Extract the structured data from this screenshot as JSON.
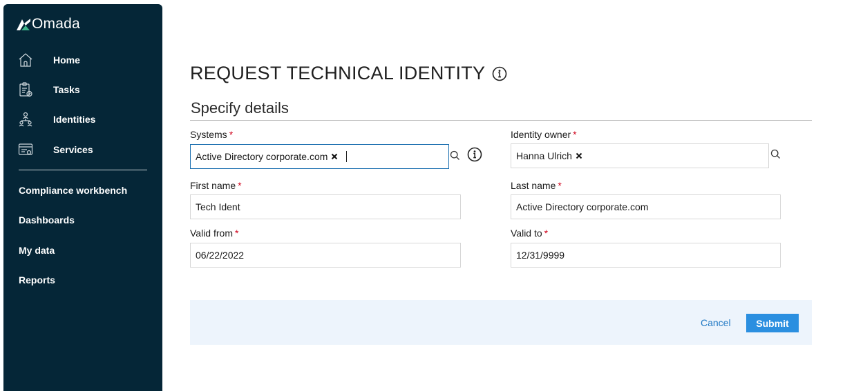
{
  "brand": {
    "name": "Omada"
  },
  "sidebar": {
    "items": [
      {
        "label": "Home",
        "icon": "home-icon"
      },
      {
        "label": "Tasks",
        "icon": "clipboard-icon"
      },
      {
        "label": "Identities",
        "icon": "people-network-icon"
      },
      {
        "label": "Services",
        "icon": "services-card-icon"
      }
    ],
    "links": [
      {
        "label": "Compliance workbench"
      },
      {
        "label": "Dashboards"
      },
      {
        "label": "My data"
      },
      {
        "label": "Reports"
      }
    ]
  },
  "page": {
    "title": "REQUEST TECHNICAL IDENTITY",
    "section": "Specify details"
  },
  "form": {
    "required_mark": "*",
    "systems": {
      "label": "Systems",
      "value": "Active Directory corporate.com"
    },
    "identity_owner": {
      "label": "Identity owner",
      "value": "Hanna Ulrich"
    },
    "first_name": {
      "label": "First name",
      "value": "Tech Ident"
    },
    "last_name": {
      "label": "Last name",
      "value": "Active Directory corporate.com"
    },
    "valid_from": {
      "label": "Valid from",
      "value": "06/22/2022"
    },
    "valid_to": {
      "label": "Valid to",
      "value": "12/31/9999"
    }
  },
  "actions": {
    "cancel": "Cancel",
    "submit": "Submit"
  },
  "colors": {
    "sidebar_bg": "#052637",
    "primary": "#2b8fe0",
    "link": "#2279c4",
    "required": "#d0021b",
    "action_bar_bg": "#edf4fc",
    "focus_border": "#1b6fb0"
  }
}
